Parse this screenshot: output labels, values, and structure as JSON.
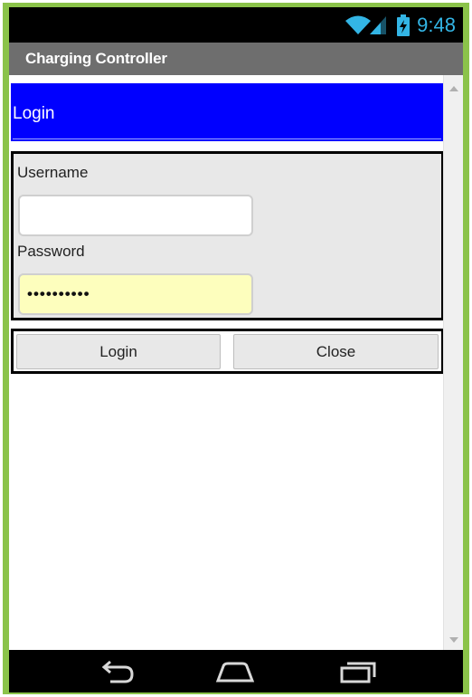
{
  "status_bar": {
    "time": "9:48",
    "icons": [
      "wifi-icon",
      "signal-icon",
      "battery-charging-icon"
    ],
    "accent": "#33b5e5"
  },
  "app": {
    "title": "Charging Controller"
  },
  "login": {
    "header": "Login",
    "username_label": "Username",
    "username_value": "",
    "password_label": "Password",
    "password_value": "••••••••••",
    "login_button": "Login",
    "close_button": "Close"
  },
  "colors": {
    "header_bg": "#0000ff",
    "frame": "#8bc34a",
    "password_bg": "#fdfebd",
    "title_bar": "#6e6e6e"
  },
  "nav_bar": {
    "buttons": [
      "back-icon",
      "home-icon",
      "recent-apps-icon"
    ]
  }
}
